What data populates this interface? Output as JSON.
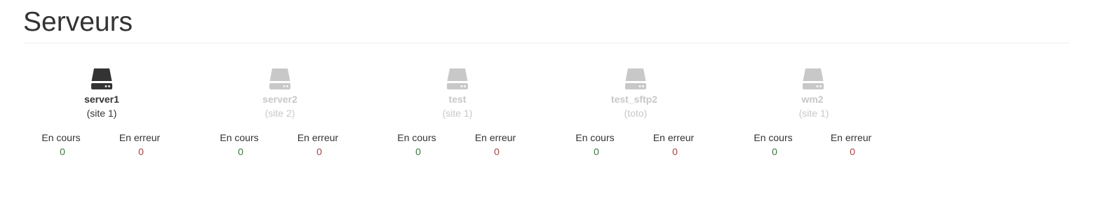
{
  "page": {
    "title": "Serveurs"
  },
  "colors": {
    "active_text": "#333333",
    "inactive_text": "#c8c8c8",
    "running_value": "#3c763d",
    "error_value": "#a94442"
  },
  "servers": [
    {
      "name": "server1",
      "site": "(site 1)",
      "active": true,
      "icon": "hard-drive-icon",
      "running_label": "En cours",
      "running_count": "0",
      "error_label": "En erreur",
      "error_count": "0"
    },
    {
      "name": "server2",
      "site": "(site 2)",
      "active": false,
      "icon": "hard-drive-icon",
      "running_label": "En cours",
      "running_count": "0",
      "error_label": "En erreur",
      "error_count": "0"
    },
    {
      "name": "test",
      "site": "(site 1)",
      "active": false,
      "icon": "hard-drive-icon",
      "running_label": "En cours",
      "running_count": "0",
      "error_label": "En erreur",
      "error_count": "0"
    },
    {
      "name": "test_sftp2",
      "site": "(toto)",
      "active": false,
      "icon": "hard-drive-icon",
      "running_label": "En cours",
      "running_count": "0",
      "error_label": "En erreur",
      "error_count": "0"
    },
    {
      "name": "wm2",
      "site": "(site 1)",
      "active": false,
      "icon": "hard-drive-icon",
      "running_label": "En cours",
      "running_count": "0",
      "error_label": "En erreur",
      "error_count": "0"
    }
  ]
}
